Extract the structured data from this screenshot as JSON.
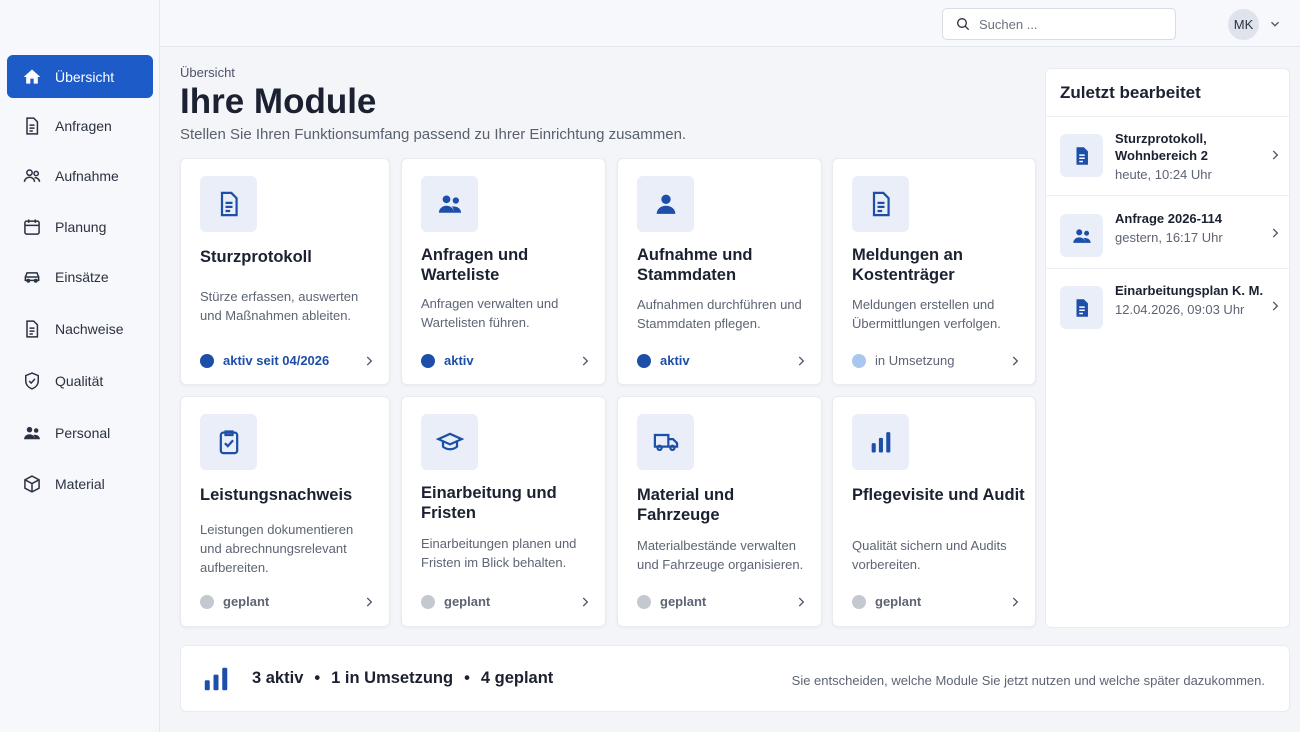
{
  "colors": {
    "accent": "#1d5bc9",
    "status_active": "#1d4fa8",
    "status_in_progress": "#a9c6ef",
    "status_planned": "#c4c9d1",
    "icon_blue": "#1d4fa8"
  },
  "sidebar": {
    "items": [
      {
        "label": "Übersicht",
        "icon": "home-icon",
        "active": true
      },
      {
        "label": "Anfragen",
        "icon": "document-icon"
      },
      {
        "label": "Aufnahme",
        "icon": "users-icon"
      },
      {
        "label": "Planung",
        "icon": "calendar-icon"
      },
      {
        "label": "Einsätze",
        "icon": "car-icon"
      },
      {
        "label": "Nachweise",
        "icon": "document-icon"
      },
      {
        "label": "Qualität",
        "icon": "shield-icon"
      },
      {
        "label": "Personal",
        "icon": "users-icon"
      },
      {
        "label": "Material",
        "icon": "box-icon"
      }
    ]
  },
  "topbar": {
    "search_placeholder": "Suchen ...",
    "avatar_initials": "MK"
  },
  "header": {
    "breadcrumb": "Übersicht",
    "title": "Ihre Module",
    "subtitle": "Stellen Sie Ihren Funktionsumfang passend zu Ihrer Einrichtung zusammen."
  },
  "modules": [
    {
      "title": "Sturzprotokoll",
      "description": "Stürze erfassen, auswerten und Maßnahmen ableiten.",
      "status": "aktiv seit 04/2026",
      "status_type": "active",
      "icon": "document-icon"
    },
    {
      "title": "Anfragen und Warteliste",
      "description": "Anfragen verwalten und Wartelisten führen.",
      "status": "aktiv",
      "status_type": "active",
      "icon": "users-icon"
    },
    {
      "title": "Aufnahme und Stammdaten",
      "description": "Aufnahmen durchführen und Stammdaten pflegen.",
      "status": "aktiv",
      "status_type": "active",
      "icon": "user-icon"
    },
    {
      "title": "Meldungen an Kostenträger",
      "description": "Meldungen erstellen und Übermittlungen verfolgen.",
      "status": "in Umsetzung",
      "status_type": "impl",
      "icon": "document-icon"
    },
    {
      "title": "Leistungsnachweis",
      "description": "Leistungen dokumentieren und abrechnungsrelevant aufbereiten.",
      "status": "geplant",
      "status_type": "plan",
      "icon": "clipboard-check-icon"
    },
    {
      "title": "Einarbeitung und Fristen",
      "description": "Einarbeitungen planen und Fristen im Blick behalten.",
      "status": "geplant",
      "status_type": "plan",
      "icon": "graduation-cap-icon"
    },
    {
      "title": "Material und Fahrzeuge",
      "description": "Materialbestände verwalten und Fahrzeuge organisieren.",
      "status": "geplant",
      "status_type": "plan",
      "icon": "truck-icon"
    },
    {
      "title": "Pflegevisite und Audit",
      "description": "Qualität sichern und Audits vorbereiten.",
      "status": "geplant",
      "status_type": "plan",
      "icon": "bar-chart-icon"
    }
  ],
  "recent": {
    "title": "Zuletzt bearbeitet",
    "items": [
      {
        "name": "Sturzprotokoll, Wohnbereich 2",
        "time": "heute, 10:24 Uhr",
        "icon": "document-icon"
      },
      {
        "name": "Anfrage 2026-114",
        "time": "gestern, 16:17 Uhr",
        "icon": "users-icon"
      },
      {
        "name": "Einarbeitungsplan K. M.",
        "time": "12.04.2026, 09:03 Uhr",
        "icon": "document-icon"
      }
    ]
  },
  "footer": {
    "active": "3 aktiv",
    "in_progress": "1 in Umsetzung",
    "planned": "4 geplant",
    "separator": "•",
    "note": "Sie entscheiden, welche Module Sie jetzt nutzen und welche später dazukommen."
  }
}
